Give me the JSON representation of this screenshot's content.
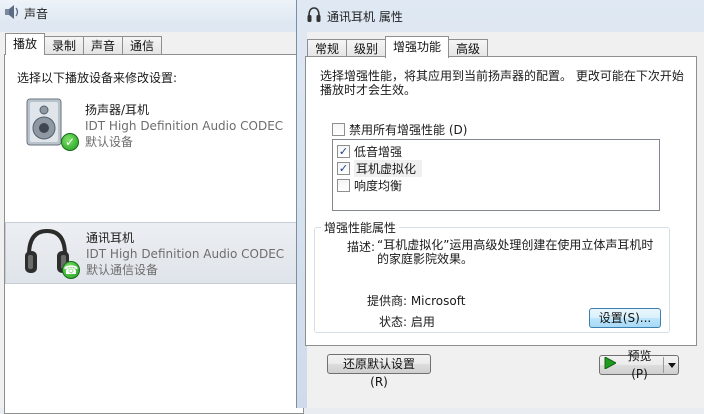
{
  "sound_window": {
    "title": "声音",
    "tabs": [
      "播放",
      "录制",
      "声音",
      "通信"
    ],
    "prompt": "选择以下播放设备来修改设置:",
    "devices": [
      {
        "name": "扬声器/耳机",
        "driver": "IDT High Definition Audio CODEC",
        "status": "默认设备",
        "icon": "speaker-icon",
        "badge": "check-icon"
      },
      {
        "name": "通讯耳机",
        "driver": "IDT High Definition Audio CODEC",
        "status": "默认通信设备",
        "icon": "headphones-icon",
        "badge": "phone-icon"
      }
    ]
  },
  "props_window": {
    "title": "通讯耳机 属性",
    "tabs": [
      "常规",
      "级别",
      "增强功能",
      "高级"
    ],
    "active_tab": "增强功能",
    "description": "选择增强性能，将其应用到当前扬声器的配置。 更改可能在下次开始播放时才会生效。",
    "disable_all": {
      "label": "禁用所有增强性能 (D)",
      "checked": false
    },
    "effects": [
      {
        "label": "低音增强",
        "checked": true
      },
      {
        "label": "耳机虚拟化",
        "checked": true
      },
      {
        "label": "响度均衡",
        "checked": false
      }
    ],
    "group": {
      "legend": "增强性能属性",
      "description_label": "描述:",
      "description_value": "“耳机虚拟化”运用高级处理创建在使用立体声耳机时的家庭影院效果。",
      "provider_label": "提供商:",
      "provider_value": "Microsoft",
      "status_label": "状态:",
      "status_value": "启用",
      "settings_button": "设置(S)..."
    },
    "restore_button": "还原默认设置 (R)",
    "preview_button": "预览 (P)"
  },
  "colors": {
    "check_green": "#1f9a1f",
    "title_gradient_top": "#dfe8f3",
    "focus_blue": "#3c7fb1"
  }
}
